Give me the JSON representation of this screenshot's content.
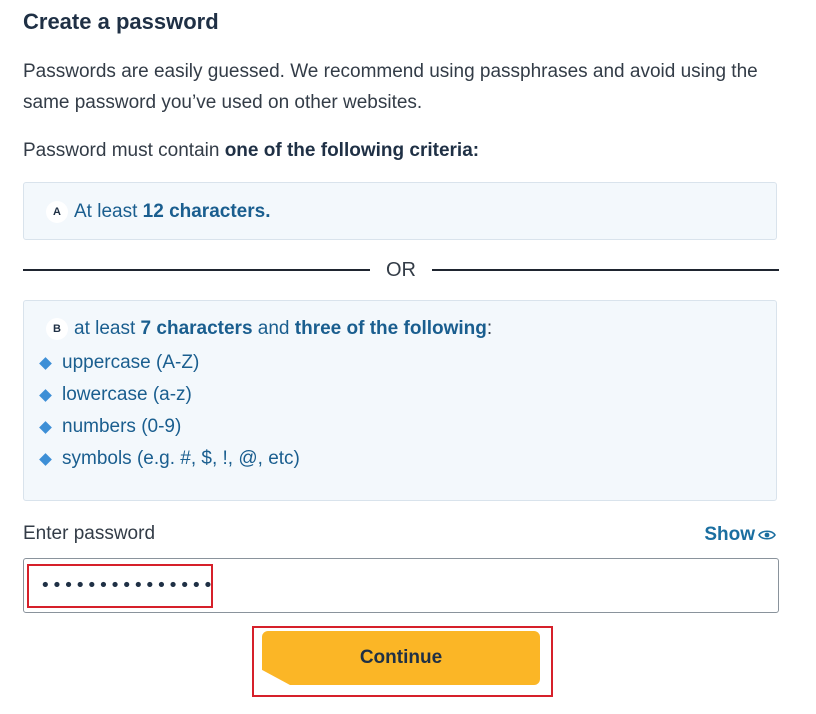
{
  "page": {
    "title": "Create a password",
    "intro": "Passwords are easily guessed. We recommend using passphrases and avoid using the same password you’ve used on other websites.",
    "criteria_lead_prefix": "Password must contain ",
    "criteria_lead_bold": "one of the following criteria:"
  },
  "option_a": {
    "badge": "A",
    "prefix": "At least ",
    "bold": "12 characters."
  },
  "divider": {
    "text": "OR"
  },
  "option_b": {
    "badge": "B",
    "prefix": "at least ",
    "bold1": "7 characters",
    "middle": " and ",
    "bold2": "three of the following",
    "suffix": ":",
    "rules": [
      "uppercase (A-Z)",
      "lowercase (a-z)",
      "numbers (0-9)",
      "symbols (e.g. #, $, !, @, etc)"
    ]
  },
  "password": {
    "label": "Enter password",
    "show_label": "Show",
    "value": "passwordexample"
  },
  "continue_label": "Continue",
  "colors": {
    "accent_blue": "#1a5e8f",
    "button_yellow": "#fbb626",
    "highlight_red": "#d6202a",
    "box_bg": "#f3f8fc"
  }
}
